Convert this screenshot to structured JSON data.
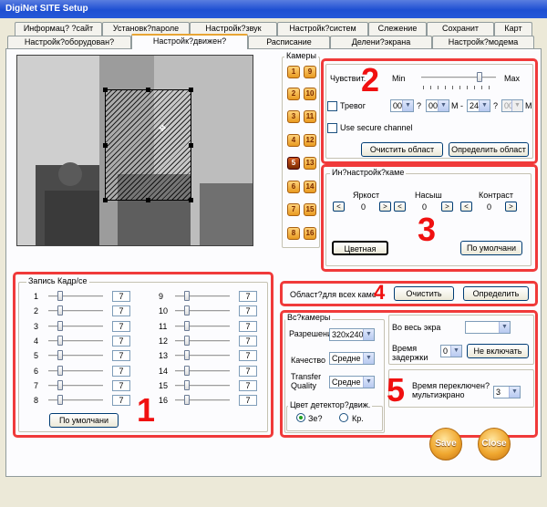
{
  "window": {
    "title": "DigiNet SITE Setup"
  },
  "tabs_row1": [
    {
      "label": "Информац? ?сайт"
    },
    {
      "label": "Установк?пароле"
    },
    {
      "label": "Настройк?звук"
    },
    {
      "label": "Настройк?систем"
    },
    {
      "label": "Слежение"
    },
    {
      "label": "Сохранит"
    },
    {
      "label": "Карт"
    }
  ],
  "tabs_row2": [
    {
      "label": "Настройк?оборудован?"
    },
    {
      "label": "Настройк?движен?"
    },
    {
      "label": "Расписание"
    },
    {
      "label": "Делени?экрана"
    },
    {
      "label": "Настройк?модема"
    }
  ],
  "cameras": {
    "label": "Камеры",
    "buttons": [
      "1",
      "9",
      "2",
      "10",
      "3",
      "11",
      "4",
      "12",
      "5",
      "13",
      "6",
      "14",
      "7",
      "15",
      "8",
      "16"
    ],
    "selected": "5"
  },
  "sensitivity": {
    "label": "Чувствит.",
    "min_label": "Min",
    "max_label": "Max",
    "value": 0.78,
    "alarm_label": "Тревог",
    "hour_from": "00",
    "min_from": "00",
    "hour_to": "24",
    "min_to": "00",
    "q_mark": "?",
    "m_label": "M",
    "m_dash_label": "M -",
    "secure_label": "Use secure channel",
    "clear_area": "Очистить област",
    "define_area": "Определить област"
  },
  "image_settings": {
    "label": "Ин?настройк?каме",
    "brightness_label": "Яркост",
    "saturation_label": "Насыш",
    "contrast_label": "Контраст",
    "brightness": "0",
    "saturation": "0",
    "contrast": "0",
    "arrow_left": "<",
    "arrow_right": ">",
    "color_button": "Цветная",
    "default_button": "По умолчани"
  },
  "recording": {
    "label": "Запись Кадр/се",
    "rows": [
      {
        "left": "1",
        "left_val": "7",
        "right": "9",
        "right_val": "7"
      },
      {
        "left": "2",
        "left_val": "7",
        "right": "10",
        "right_val": "7"
      },
      {
        "left": "3",
        "left_val": "7",
        "right": "11",
        "right_val": "7"
      },
      {
        "left": "4",
        "left_val": "7",
        "right": "12",
        "right_val": "7"
      },
      {
        "left": "5",
        "left_val": "7",
        "right": "13",
        "right_val": "7"
      },
      {
        "left": "6",
        "left_val": "7",
        "right": "14",
        "right_val": "7"
      },
      {
        "left": "7",
        "left_val": "7",
        "right": "15",
        "right_val": "7"
      },
      {
        "left": "8",
        "left_val": "7",
        "right": "16",
        "right_val": "7"
      }
    ],
    "default_button": "По умолчани"
  },
  "all_cams_area": {
    "label": "Област?для всех каме",
    "clear": "Очистить",
    "define": "Определить"
  },
  "all_cams": {
    "label": "Вс?камеры",
    "resolution_label": "Разрешени",
    "resolution": "320x240",
    "quality_label": "Качество",
    "quality": "Средне",
    "transfer_label_1": "Transfer",
    "transfer_label_2": "Quality",
    "transfer": "Средне",
    "detector_color_label": "Цвет детектор?движ.",
    "green_label": "Зе?",
    "red_label": "Кр.",
    "fullscreen_label": "Во весь экра",
    "fullscreen_value": "",
    "delay_label_1": "Время",
    "delay_label_2": "задержки",
    "delay_value": "0",
    "not_enabled": "Не включать",
    "switch_time_label_1": "Время переключен?",
    "switch_time_label_2": "мультиэкрано",
    "switch_time": "3"
  },
  "annotations": {
    "n1": "1",
    "n2": "2",
    "n3": "3",
    "n4": "4",
    "n5": "5"
  },
  "actions": {
    "save": "Save",
    "close": "Close"
  },
  "colors": {
    "annotation_red": "#f03a3a",
    "selected_cam": "#7a2a00"
  }
}
